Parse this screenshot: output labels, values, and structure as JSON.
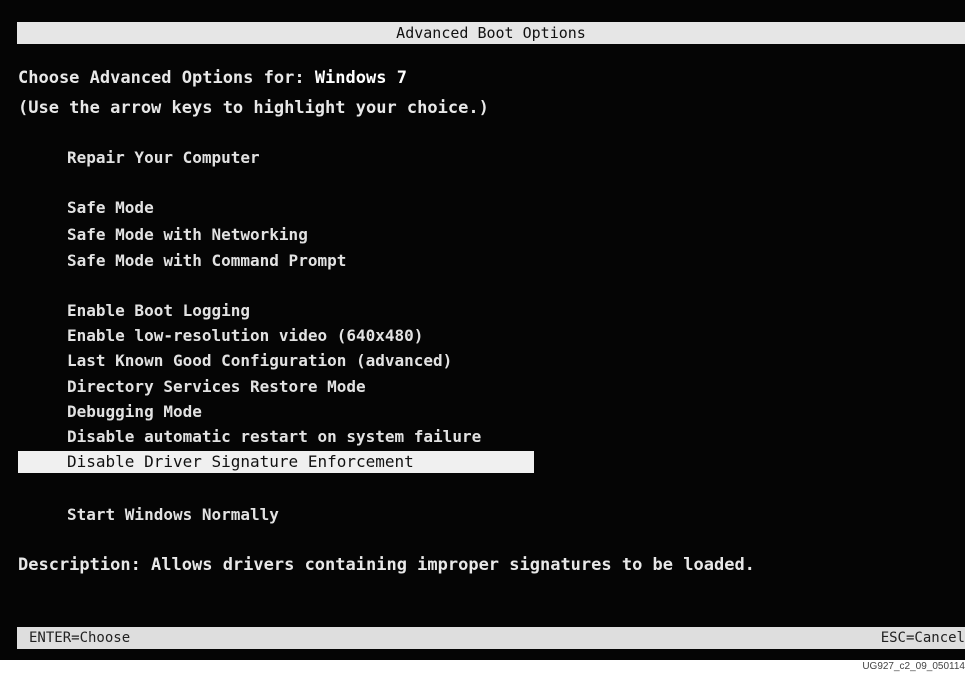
{
  "title": "Advanced Boot Options",
  "prompt": {
    "choose_prefix": "Choose Advanced Options for: ",
    "os_name": "Windows 7",
    "instruction": "(Use the arrow keys to highlight your choice.)"
  },
  "menu": {
    "repair": "Repair Your Computer",
    "safe_mode": "Safe Mode",
    "safe_mode_networking": "Safe Mode with Networking",
    "safe_mode_cmd": "Safe Mode with Command Prompt",
    "boot_logging": "Enable Boot Logging",
    "low_res": "Enable low-resolution video (640x480)",
    "last_known_good": "Last Known Good Configuration (advanced)",
    "ds_restore": "Directory Services Restore Mode",
    "debugging": "Debugging Mode",
    "disable_restart": "Disable automatic restart on system failure",
    "disable_sig": "Disable Driver Signature Enforcement",
    "start_normally": "Start Windows Normally",
    "selected": "Disable Driver Signature Enforcement"
  },
  "description": "Description: Allows drivers containing improper signatures to be loaded.",
  "footer": {
    "enter": "ENTER=Choose",
    "esc": "ESC=Cancel"
  },
  "caption": "UG927_c2_09_050114",
  "colors": {
    "background": "#050505",
    "text": "#e8e8e8",
    "bar": "#e6e6e6",
    "highlight": "#f0f0f0"
  }
}
